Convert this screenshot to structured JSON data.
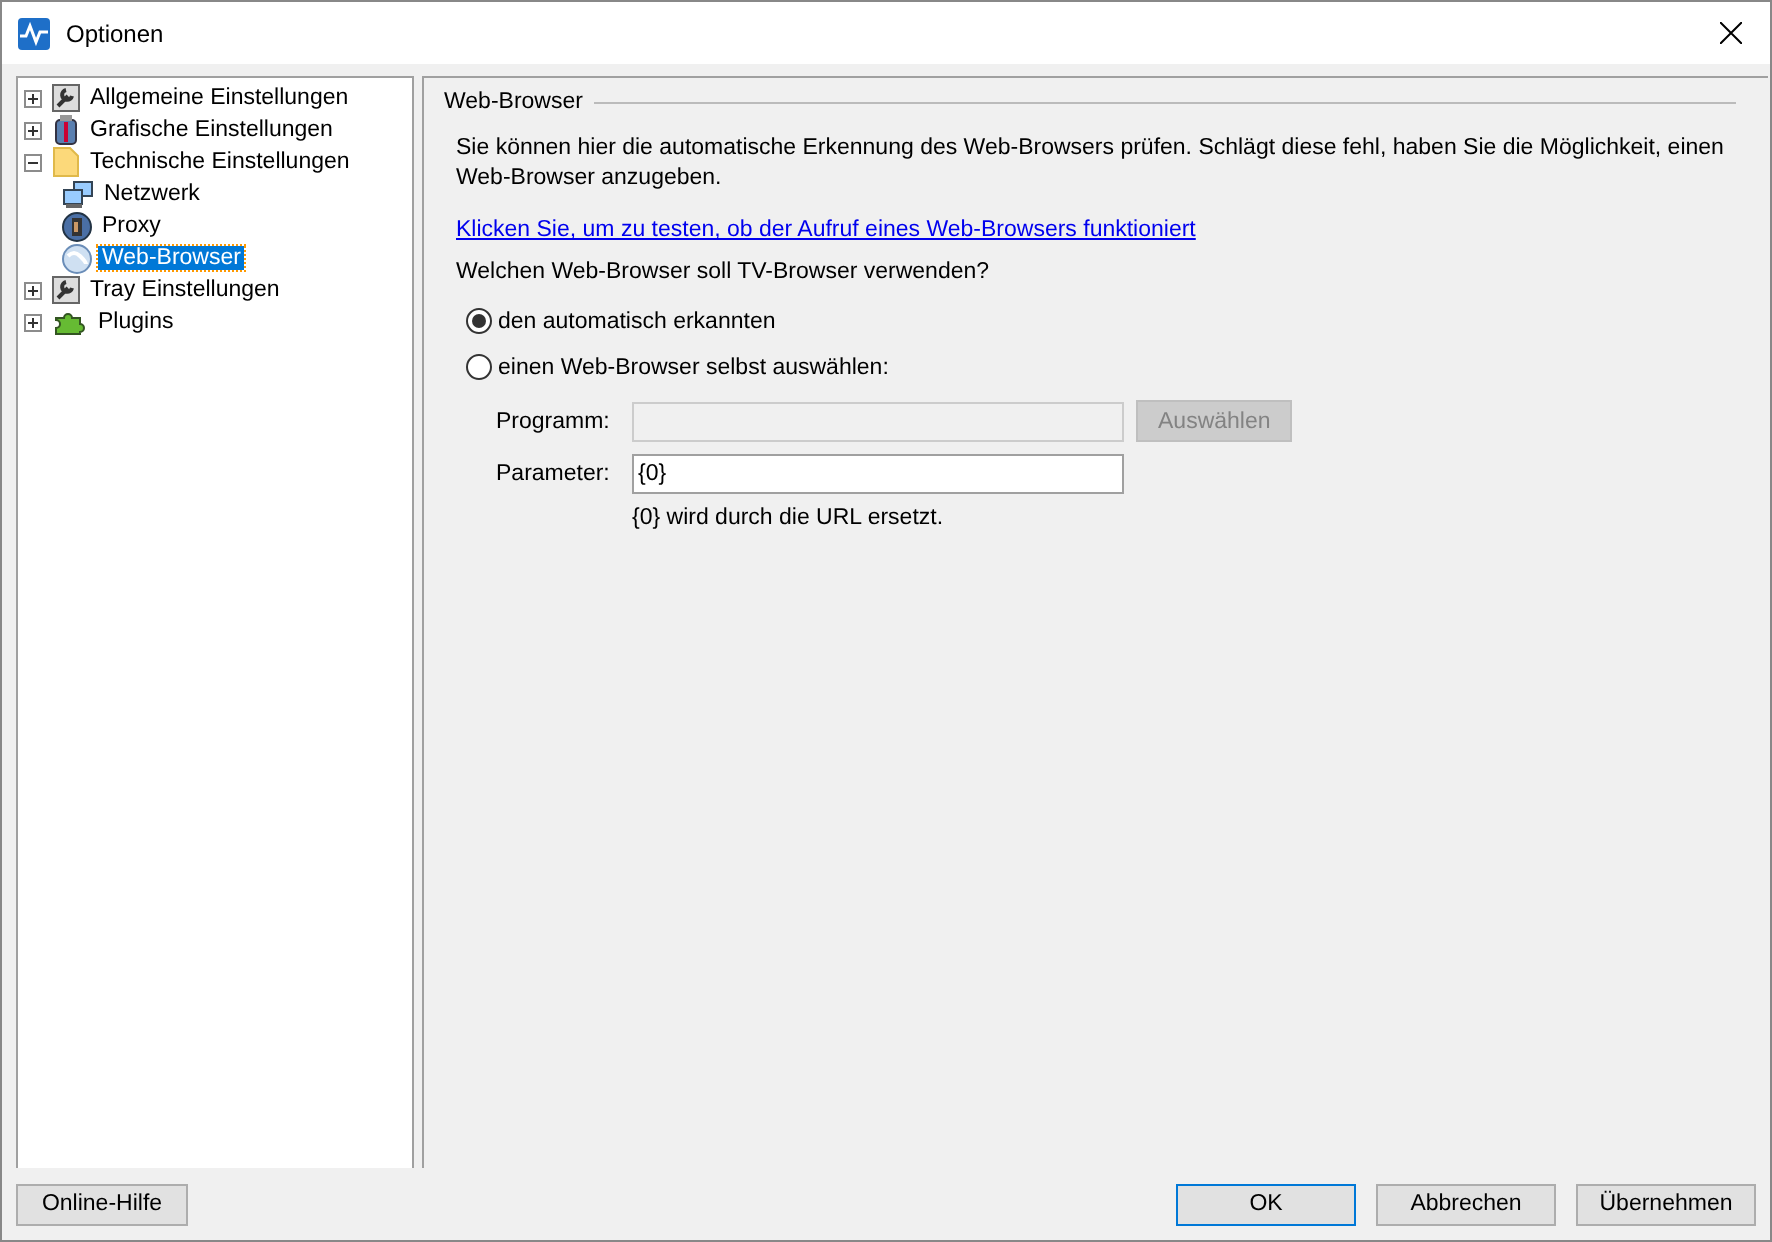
{
  "window": {
    "title": "Optionen"
  },
  "tree": [
    {
      "label": "Allgemeine Einstellungen",
      "kind": "wrench",
      "expanded": false,
      "selected": false
    },
    {
      "label": "Grafische Einstellungen",
      "kind": "paint",
      "expanded": false,
      "selected": false
    },
    {
      "label": "Technische Einstellungen",
      "kind": "folder",
      "expanded": true,
      "selected": false,
      "children": [
        {
          "label": "Netzwerk",
          "kind": "network",
          "selected": false
        },
        {
          "label": "Proxy",
          "kind": "proxy",
          "selected": false
        },
        {
          "label": "Web-Browser",
          "kind": "globe",
          "selected": true
        }
      ]
    },
    {
      "label": "Tray Einstellungen",
      "kind": "wrench",
      "expanded": false,
      "selected": false
    },
    {
      "label": "Plugins",
      "kind": "puzzle",
      "expanded": false,
      "selected": false
    }
  ],
  "panel": {
    "title": "Web-Browser",
    "description": "Sie können hier die automatische Erkennung des Web-Browsers prüfen. Schlägt diese fehl, haben Sie die Möglichkeit, einen Web-Browser anzugeben.",
    "test_link": "Klicken Sie, um zu testen, ob der Aufruf eines Web-Browsers funktioniert",
    "question": "Welchen Web-Browser soll TV-Browser verwenden?",
    "options": [
      {
        "label": "den automatisch erkannten",
        "selected": true
      },
      {
        "label": "einen Web-Browser selbst auswählen:",
        "selected": false
      }
    ],
    "program": {
      "label": "Programm:",
      "disabled": true,
      "button": "Auswählen"
    },
    "parameter": {
      "label": "Parameter:",
      "value": "{0}",
      "hint": "{0} wird durch die URL ersetzt."
    }
  },
  "buttons": {
    "help": "Online-Hilfe",
    "actions": [
      {
        "label": "OK",
        "default": true
      },
      {
        "label": "Abbrechen",
        "default": false
      },
      {
        "label": "Übernehmen",
        "default": false
      }
    ]
  }
}
